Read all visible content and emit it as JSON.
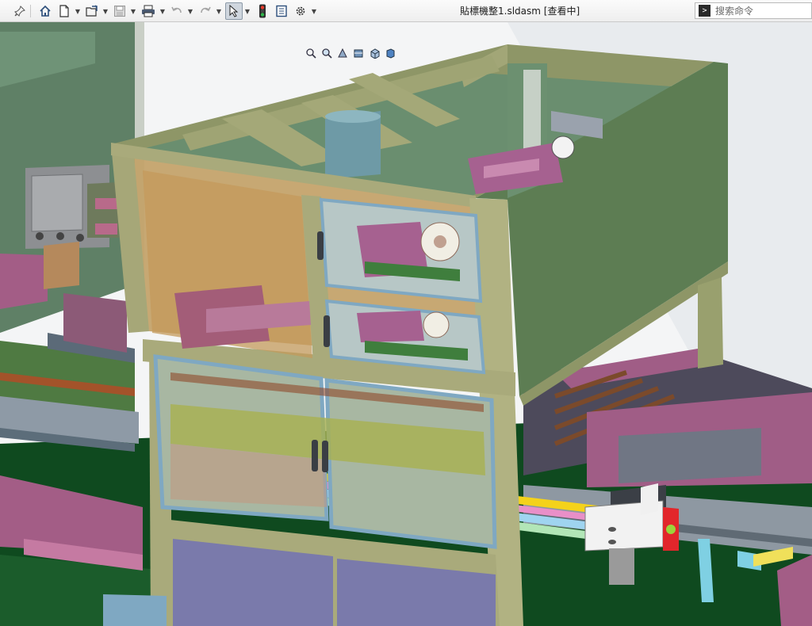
{
  "toolbar": {
    "document_title": "貼標機整1.sldasm [查看中]",
    "search": {
      "placeholder": "搜索命令",
      "prompt_icon": "command-prompt-icon",
      "prompt_glyph": ">"
    },
    "buttons": [
      {
        "name": "pin-icon"
      },
      {
        "name": "home-icon"
      },
      {
        "name": "new-document-icon"
      },
      {
        "name": "open-icon"
      },
      {
        "name": "save-icon"
      },
      {
        "name": "print-icon"
      },
      {
        "name": "undo-icon"
      },
      {
        "name": "redo-icon"
      },
      {
        "name": "select-icon",
        "active": true
      },
      {
        "name": "traffic-light-icon"
      },
      {
        "name": "file-properties-icon"
      },
      {
        "name": "options-gear-icon"
      }
    ]
  },
  "heads_up_toolbar": [
    {
      "name": "zoom-to-fit-icon"
    },
    {
      "name": "zoom-to-area-icon"
    },
    {
      "name": "previous-view-icon"
    },
    {
      "name": "section-view-icon"
    },
    {
      "name": "view-orientation-icon"
    },
    {
      "name": "display-style-icon"
    }
  ],
  "colors": {
    "frame_olive": "#9a9d6c",
    "panel_green": "#74997d",
    "sky_grey": "#e9ecef",
    "magenta_parts": "#a35d86",
    "aluminum_blue": "#7fa8c2",
    "floor_dark_green": "#0f4a1f",
    "tan_glass": "#c99a5f",
    "purple_panel": "#7878a8"
  }
}
